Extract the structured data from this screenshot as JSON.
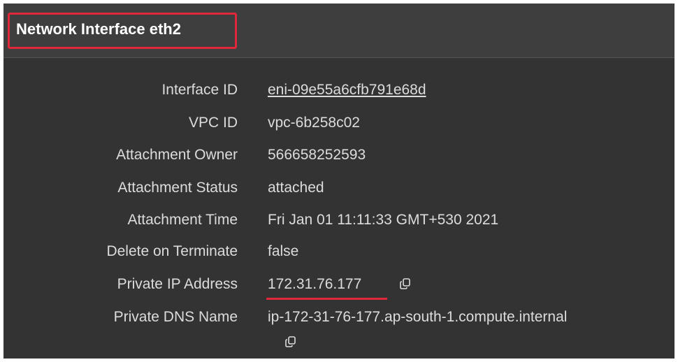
{
  "header": {
    "title": "Network Interface eth2"
  },
  "details": [
    {
      "label": "Interface ID",
      "value": "eni-09e55a6cfb791e68d"
    },
    {
      "label": "VPC ID",
      "value": "vpc-6b258c02"
    },
    {
      "label": "Attachment Owner",
      "value": "566658252593"
    },
    {
      "label": "Attachment Status",
      "value": "attached"
    },
    {
      "label": "Attachment Time",
      "value": "Fri Jan 01 11:11:33 GMT+530 2021"
    },
    {
      "label": "Delete on Terminate",
      "value": "false"
    },
    {
      "label": "Private IP Address",
      "value": "172.31.76.177"
    },
    {
      "label": "Private DNS Name",
      "value": "ip-172-31-76-177.ap-south-1.compute.internal"
    }
  ],
  "icons": {
    "copy": "copy-icon"
  },
  "colors": {
    "background": "#333333",
    "header_background": "#3e3e3e",
    "text": "#dcdcdc",
    "highlight": "#e0283a"
  }
}
